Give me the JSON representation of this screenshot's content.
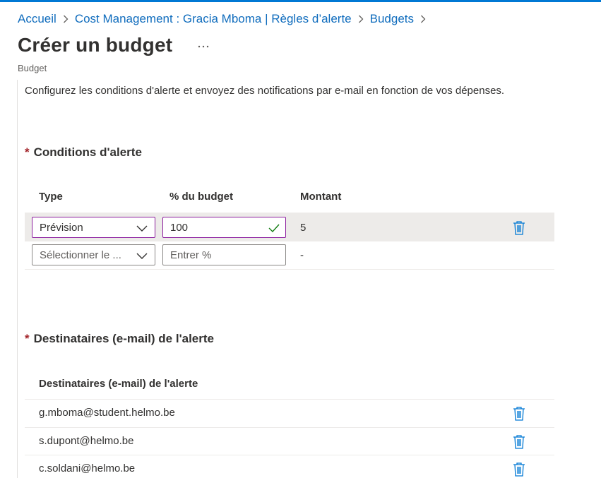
{
  "breadcrumb": {
    "items": [
      "Accueil",
      "Cost Management : Gracia Mboma | Règles d’alerte",
      "Budgets"
    ]
  },
  "header": {
    "title": "Créer un budget",
    "more": "...",
    "subtitle": "Budget"
  },
  "description": "Configurez les conditions d'alerte et envoyez des notifications par e-mail en fonction de vos dépenses.",
  "conditions": {
    "required_mark": "*",
    "title": "Conditions d'alerte",
    "columns": {
      "type": "Type",
      "percent": "% du budget",
      "amount": "Montant"
    },
    "rows": [
      {
        "type": "Prévision",
        "percent": "100",
        "amount": "5"
      },
      {
        "type_placeholder": "Sélectionner le ...",
        "percent_placeholder": "Entrer %",
        "amount": "-"
      }
    ]
  },
  "recipients": {
    "required_mark": "*",
    "title": "Destinataires (e-mail) de l'alerte",
    "column": "Destinataires (e-mail) de l'alerte",
    "emails": [
      "g.mboma@student.helmo.be",
      "s.dupont@helmo.be",
      "c.soldani@helmo.be"
    ]
  },
  "colors": {
    "accent": "#0078d4",
    "link": "#0f6cbd",
    "required": "#a4262c",
    "focus_border": "#8b1c9e",
    "check": "#107c10",
    "row_selected": "#edebe9",
    "trash": "#0078d4"
  },
  "icons": {
    "chevron": "chevron-right-icon",
    "more": "more-horizontal-icon",
    "dropdown": "chevron-down-icon",
    "valid": "checkmark-icon",
    "delete": "trash-icon"
  }
}
